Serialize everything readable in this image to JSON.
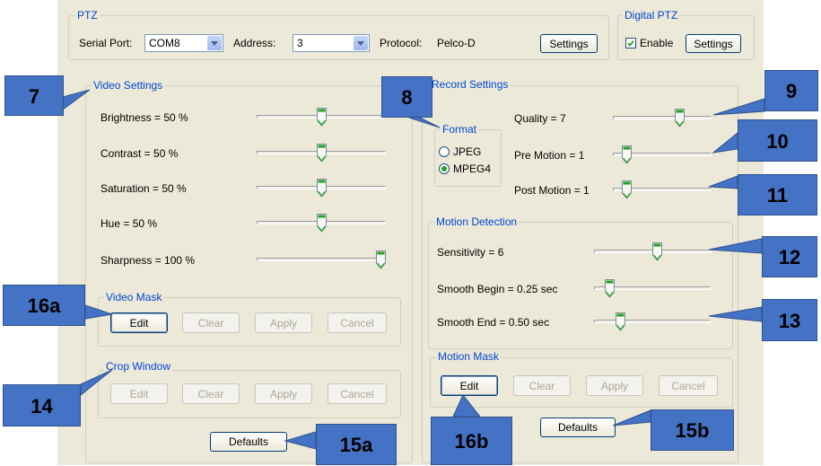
{
  "ptz": {
    "legend": "PTZ",
    "serial_port_label": "Serial Port:",
    "serial_port_value": "COM8",
    "address_label": "Address:",
    "address_value": "3",
    "protocol_label": "Protocol:",
    "protocol_value": "Pelco-D",
    "settings_label": "Settings"
  },
  "digital_ptz": {
    "legend": "Digital PTZ",
    "enable_label": "Enable",
    "enable_checked": true,
    "settings_label": "Settings"
  },
  "video_settings": {
    "legend": "Video Settings",
    "sliders": [
      {
        "label": "Brightness = 50 %",
        "level": 0.5
      },
      {
        "label": "Contrast = 50 %",
        "level": 0.5
      },
      {
        "label": "Saturation = 50 %",
        "level": 0.5
      },
      {
        "label": "Hue = 50 %",
        "level": 0.5
      },
      {
        "label": "Sharpness = 100 %",
        "level": 1.0
      }
    ]
  },
  "video_mask": {
    "legend": "Video Mask",
    "buttons": [
      "Edit",
      "Clear",
      "Apply",
      "Cancel"
    ]
  },
  "crop_window": {
    "legend": "Crop Window",
    "buttons": [
      "Edit",
      "Clear",
      "Apply",
      "Cancel"
    ]
  },
  "defaults_left": "Defaults",
  "record_settings": {
    "legend": "Record Settings",
    "format_legend": "Format",
    "format_options": [
      "JPEG",
      "MPEG4"
    ],
    "format_selected": "MPEG4",
    "sliders": [
      {
        "label": "Quality = 7",
        "level": 0.7
      },
      {
        "label": "Pre Motion = 1",
        "level": 0.1
      },
      {
        "label": "Post Motion = 1",
        "level": 0.1
      }
    ]
  },
  "motion_detection": {
    "legend": "Motion Detection",
    "sliders": [
      {
        "label": "Sensitivity = 6",
        "level": 0.55
      },
      {
        "label": "Smooth Begin = 0.25 sec",
        "level": 0.1
      },
      {
        "label": "Smooth End = 0.50 sec",
        "level": 0.2
      }
    ]
  },
  "motion_mask": {
    "legend": "Motion Mask",
    "buttons": [
      "Edit",
      "Clear",
      "Apply",
      "Cancel"
    ]
  },
  "defaults_right": "Defaults",
  "callouts": {
    "c7": "7",
    "c8": "8",
    "c9": "9",
    "c10": "10",
    "c11": "11",
    "c12": "12",
    "c13": "13",
    "c14": "14",
    "c15a": "15a",
    "c15b": "15b",
    "c16a": "16a",
    "c16b": "16b"
  },
  "colors": {
    "panel_bg": "#ece9d8",
    "legend_text": "#0046d5",
    "callout_fill": "#4472c4",
    "thumb_green": "#21a121"
  }
}
